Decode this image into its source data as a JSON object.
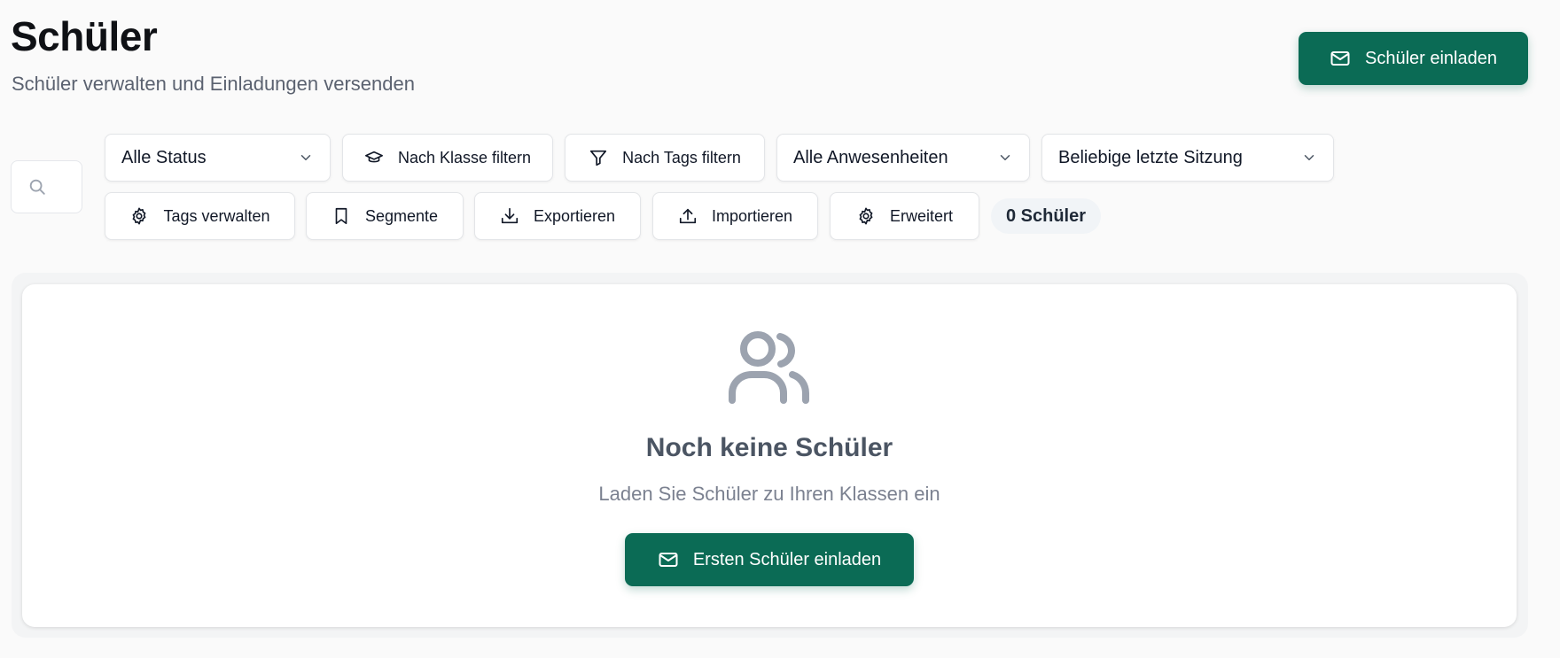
{
  "header": {
    "title": "Schüler",
    "subtitle": "Schüler verwalten und Einladungen versenden",
    "invite_button_label": "Schüler einladen",
    "invite_button_icon": "mail-icon"
  },
  "toolbar": {
    "search": {
      "placeholder": "",
      "value": "",
      "icon": "search-icon"
    },
    "status_select": {
      "value": "Alle Status"
    },
    "class_filter_label": "Nach Klasse filtern",
    "tags_filter_label": "Nach Tags filtern",
    "attendance_select": {
      "value": "Alle Anwesenheiten"
    },
    "last_session_select": {
      "value": "Beliebige letzte Sitzung"
    },
    "manage_tags_label": "Tags verwalten",
    "segments_label": "Segmente",
    "export_label": "Exportieren",
    "import_label": "Importieren",
    "advanced_label": "Erweitert",
    "student_count": "0 Schüler"
  },
  "empty_state": {
    "icon": "users-icon",
    "title": "Noch keine Schüler",
    "text": "Laden Sie Schüler zu Ihren Klassen ein",
    "button_label": "Ersten Schüler einladen"
  },
  "colors": {
    "primary": "#0b6b55",
    "background": "#fafafa",
    "muted_icon": "#9ca3af"
  }
}
